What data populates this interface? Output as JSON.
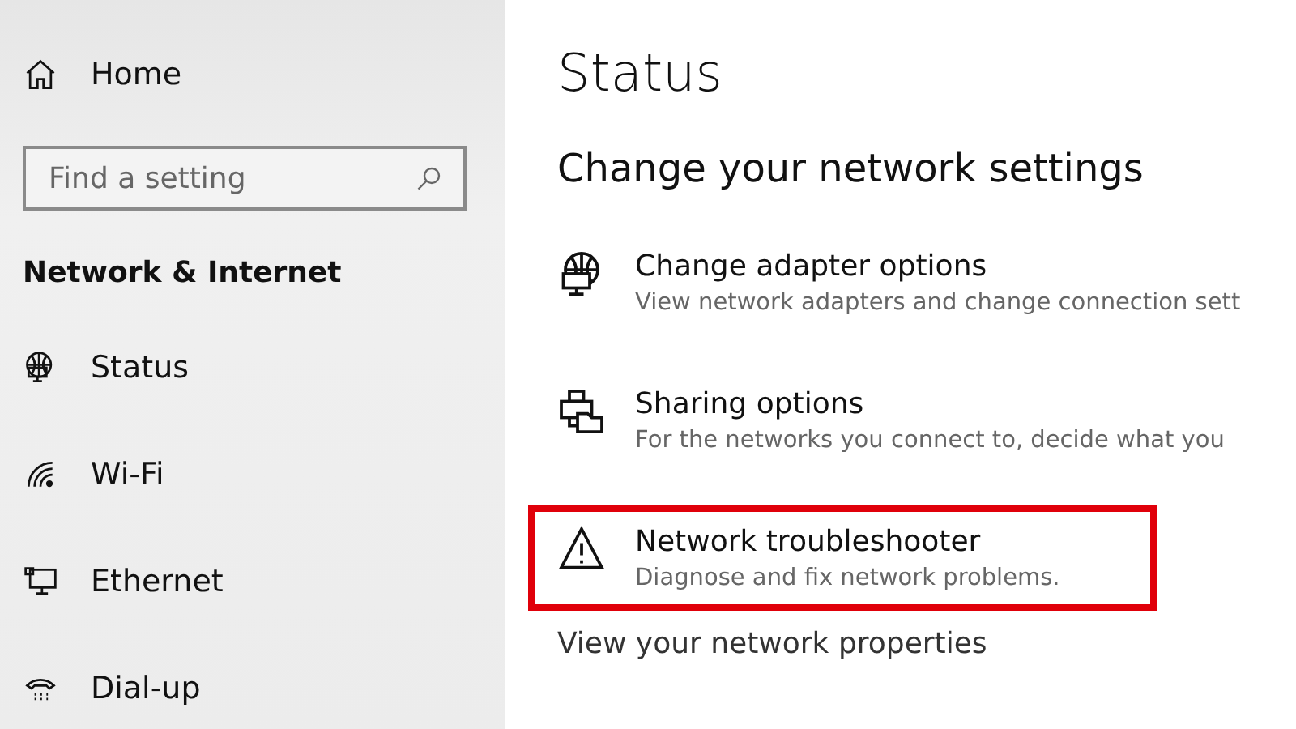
{
  "sidebar": {
    "home": {
      "label": "Home"
    },
    "search": {
      "placeholder": "Find a setting"
    },
    "section_title": "Network & Internet",
    "items": [
      {
        "kind": "status",
        "label": "Status"
      },
      {
        "kind": "wifi",
        "label": "Wi-Fi"
      },
      {
        "kind": "ethernet",
        "label": "Ethernet"
      },
      {
        "kind": "dialup",
        "label": "Dial-up"
      }
    ]
  },
  "main": {
    "title": "Status",
    "subtitle": "Change your network settings",
    "options": [
      {
        "kind": "adapter",
        "title": "Change adapter options",
        "description": "View network adapters and change connection sett",
        "highlighted": false
      },
      {
        "kind": "sharing",
        "title": "Sharing options",
        "description": "For the networks you connect to, decide what you",
        "highlighted": false
      },
      {
        "kind": "troubleshooter",
        "title": "Network troubleshooter",
        "description": "Diagnose and fix network problems.",
        "highlighted": true
      }
    ],
    "link": "View your network properties"
  }
}
